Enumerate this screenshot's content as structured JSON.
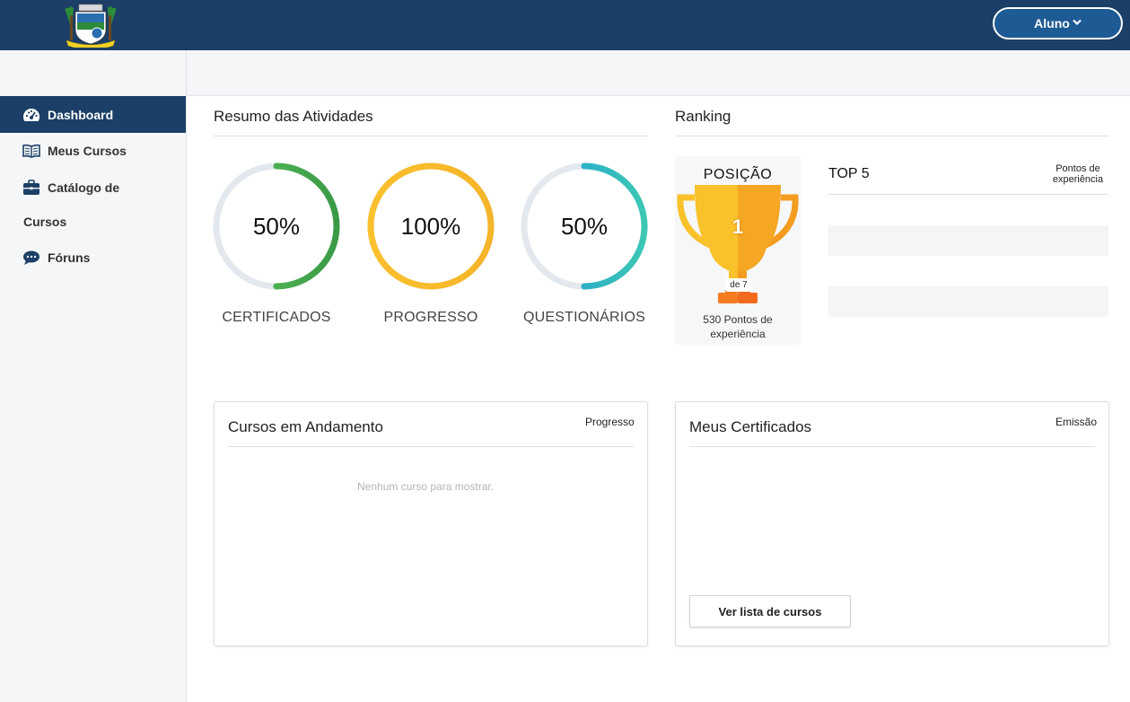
{
  "header": {
    "user_menu_label": "Aluno"
  },
  "sidebar": {
    "items": [
      {
        "label": "Dashboard",
        "icon": "dashboard-icon"
      },
      {
        "label": "Meus Cursos",
        "icon": "book-icon"
      },
      {
        "label": "Catálogo de",
        "label_line2": "Cursos",
        "icon": "briefcase-icon"
      },
      {
        "label": "Fóruns",
        "icon": "chat-icon"
      }
    ]
  },
  "summary": {
    "title": "Resumo das Atividades",
    "rings": [
      {
        "value_text": "50%",
        "value": 0.5,
        "label": "CERTIFICADOS",
        "color_start": "#5cc45c",
        "color_end": "#3a9a46"
      },
      {
        "value_text": "100%",
        "value": 1.0,
        "label": "PROGRESSO",
        "color_start": "#fbc02d",
        "color_end": "#f5b52a"
      },
      {
        "value_text": "50%",
        "value": 0.5,
        "label": "QUESTIONÁRIOS",
        "color_start": "#1e9ad6",
        "color_end": "#3cc8b4"
      }
    ],
    "ring_track_color": "#e3e8ee"
  },
  "ranking": {
    "title": "Ranking",
    "position_label": "POSIÇÃO",
    "position": "1",
    "of_total": "de 7",
    "points_text": "530 Pontos de experiência",
    "top5_title": "TOP 5",
    "top5_column": "Pontos de experiência"
  },
  "courses_card": {
    "title": "Cursos em Andamento",
    "column": "Progresso",
    "empty_message": "Nenhum curso para mostrar."
  },
  "certificates_card": {
    "title": "Meus Certificados",
    "column": "Emissão",
    "button_label": "Ver lista de cursos"
  },
  "colors": {
    "primary": "#1b3f66",
    "accent_button": "#1e5a93"
  }
}
